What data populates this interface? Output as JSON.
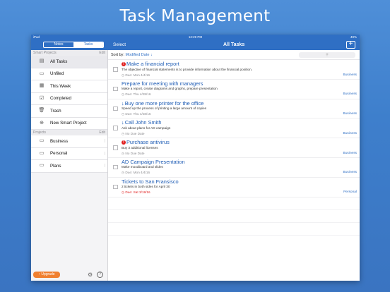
{
  "headline": "Task Management",
  "statusbar": {
    "device": "iPad",
    "time": "12:29 PM",
    "battery": "49%"
  },
  "navbar": {
    "tabs": [
      {
        "label": "Notes"
      },
      {
        "label": "Tasks"
      }
    ],
    "active_tab": "Tasks",
    "select_label": "Select",
    "title": "All Tasks",
    "add_label": "+"
  },
  "sidebar": {
    "smart_projects_header": "Smart Projects",
    "projects_header": "Projects",
    "edit_label": "Edit",
    "smart_items": [
      {
        "label": "All Tasks",
        "icon": "clipboard-icon",
        "glyph": "▤"
      },
      {
        "label": "Unfiled",
        "icon": "inbox-icon",
        "glyph": "▭"
      },
      {
        "label": "This Week",
        "icon": "calendar-icon",
        "glyph": "▦"
      },
      {
        "label": "Completed",
        "icon": "checkbox-checked-icon",
        "glyph": "☑"
      },
      {
        "label": "Trash",
        "icon": "trash-icon",
        "glyph": "🗑"
      },
      {
        "label": "New Smart Project",
        "icon": "add-project-icon",
        "glyph": "⊕"
      }
    ],
    "projects": [
      {
        "label": "Business",
        "icon": "folder-icon",
        "glyph": "▭"
      },
      {
        "label": "Personal",
        "icon": "folder-icon",
        "glyph": "▭"
      },
      {
        "label": "Plans",
        "icon": "folder-icon",
        "glyph": "▭"
      }
    ],
    "upgrade_label": "Upgrade",
    "help_label": "?"
  },
  "sort": {
    "label": "Sort by:",
    "value": "Modified Date",
    "direction_glyph": "↓"
  },
  "search": {
    "placeholder": "Search"
  },
  "tasks": [
    {
      "title": "Make a financial report",
      "marker": "high",
      "description": "The objective of financial statements is to provide information about the financial position.",
      "due": "Due: Mon 4/4/16",
      "overdue": false,
      "project": "Business"
    },
    {
      "title": "Prepare for meeting with managers",
      "marker": "none",
      "description": "Make a report, create diagrams and graphs, prepare presentation",
      "due": "Due: Thu 4/28/16",
      "overdue": false,
      "project": "Business"
    },
    {
      "title": "Buy one more printer for the office",
      "marker": "low",
      "description": "Speed up the process of printing a large amount of copies",
      "due": "Due: Thu 4/28/16",
      "overdue": false,
      "project": "Business"
    },
    {
      "title": "Call John Smith",
      "marker": "low",
      "description": "Ask about plans for AD campaign",
      "due": "No Due Date",
      "overdue": false,
      "project": "Business"
    },
    {
      "title": "Purchase antivirus",
      "marker": "high",
      "description": "Buy 3 additional licenses",
      "due": "No Due Date",
      "overdue": false,
      "project": "Business"
    },
    {
      "title": "AD Campaign Presentation",
      "marker": "none",
      "description": "Make moodboard and slides",
      "due": "Due: Mon 4/4/16",
      "overdue": false,
      "project": "Business"
    },
    {
      "title": "Tickets to San Fransisco",
      "marker": "none",
      "description": "2 tickets in both sides for April 30",
      "due": "Due: Sat 3/19/16",
      "overdue": true,
      "project": "Personal"
    }
  ],
  "colors": {
    "accent": "#2f6fc4",
    "priority_high": "#e02020",
    "upgrade": "#f08030"
  }
}
